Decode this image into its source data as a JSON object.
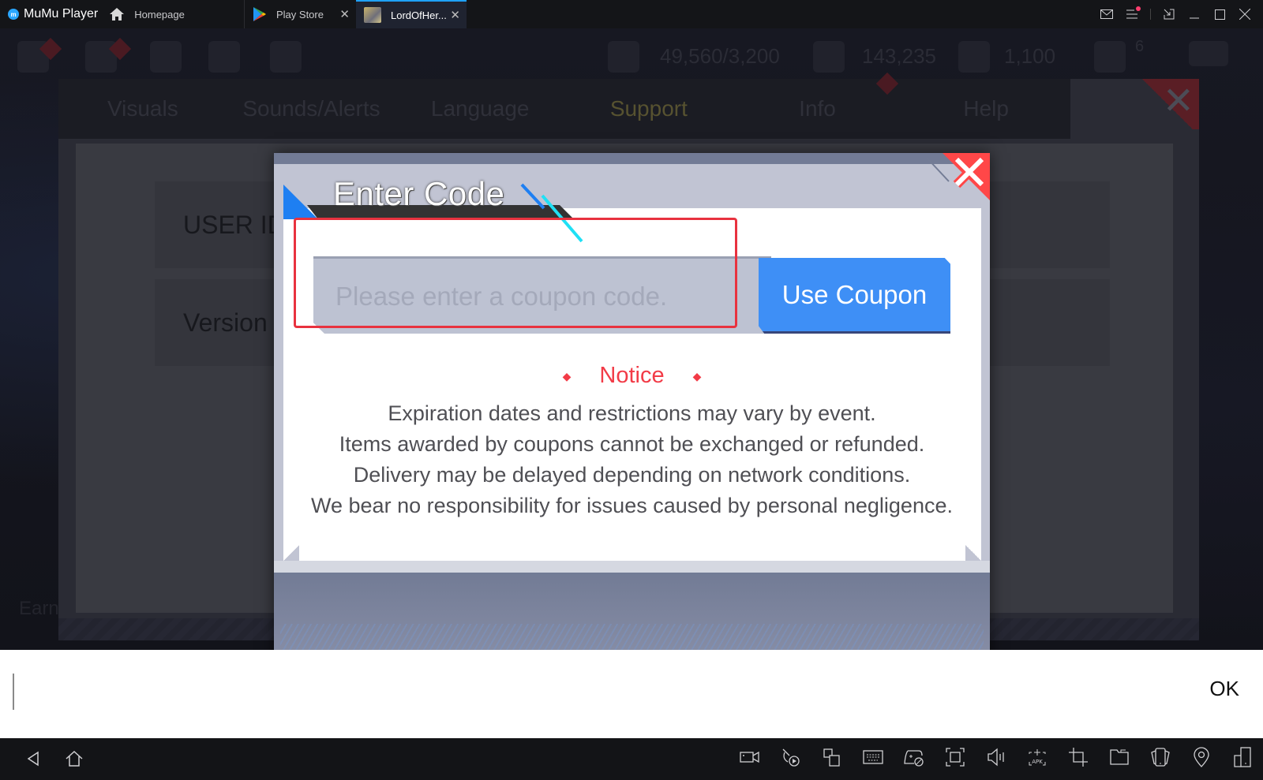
{
  "titlebar": {
    "app_name": "MuMu Player",
    "tabs": [
      {
        "label": "Homepage",
        "icon": "home-icon",
        "closable": false,
        "active": false
      },
      {
        "label": "Play Store",
        "icon": "play-store-icon",
        "closable": true,
        "active": false
      },
      {
        "label": "LordOfHer...",
        "icon": "game-thumbnail",
        "closable": true,
        "active": true
      }
    ],
    "close_glyph": "✕",
    "controls": [
      "mail-icon",
      "menu-icon",
      "fullscreen-icon",
      "minimize-icon",
      "maximize-icon",
      "close-icon"
    ]
  },
  "game_hud": {
    "resource_stamina": "49,560/3,200",
    "resource_gold": "143,235",
    "resource_gems": "1,100",
    "mail_badge": "6"
  },
  "settings": {
    "tabs": [
      "Visuals",
      "Sounds/Alerts",
      "Language",
      "Support",
      "Info",
      "Help"
    ],
    "active_tab": "Support",
    "rows": [
      "USER ID",
      "Version"
    ],
    "edge_text": "Earn"
  },
  "dialog": {
    "title": "Enter Code",
    "input_placeholder": "Please enter a coupon code.",
    "input_value": "",
    "use_coupon_label": "Use Coupon",
    "notice_title": "Notice",
    "notice_diamond": "◆",
    "notice_lines": [
      "Expiration dates and restrictions may vary by event.",
      "Items awarded by coupons cannot be exchanged or refunded.",
      "Delivery may be delayed depending on network conditions.",
      "We bear no responsibility for issues caused by personal negligence."
    ],
    "close_glyph": "✕"
  },
  "textbar": {
    "ok_label": "OK",
    "value": ""
  },
  "bottombar": {
    "nav": [
      "back-icon",
      "home-icon"
    ],
    "tools": [
      "screen-record-icon",
      "video-off-icon",
      "multi-instance-icon",
      "keyboard-icon",
      "gamepad-icon",
      "screenshot-icon",
      "volume-icon",
      "install-apk-icon",
      "crop-icon",
      "folder-icon",
      "shake-icon",
      "location-icon",
      "rotate-icon"
    ]
  },
  "colors": {
    "accent_blue": "#3e8ff6",
    "notice_red": "#f23b47",
    "highlight_red": "#e8323f",
    "tab_active_underline": "#1fa2ff"
  }
}
